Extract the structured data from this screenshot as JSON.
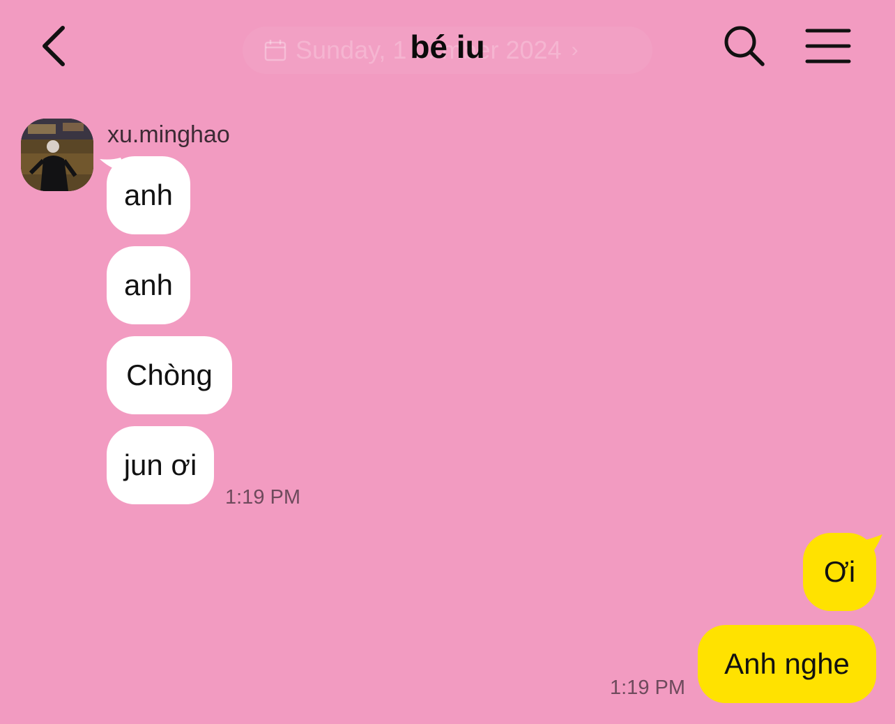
{
  "header": {
    "title": "bé iu",
    "date_label": "Sunday, 1 ... mber 2024",
    "back_icon": "chevron-left-icon",
    "search_icon": "search-icon",
    "menu_icon": "hamburger-menu-icon"
  },
  "colors": {
    "background": "#f29bc1",
    "incoming_bubble": "#ffffff",
    "outgoing_bubble": "#ffe200",
    "timestamp": "#6e4a5c"
  },
  "conversation": {
    "sender_name": "xu.minghao",
    "incoming": [
      {
        "text": "anh"
      },
      {
        "text": "anh"
      },
      {
        "text": "Chòng"
      },
      {
        "text": "jun ơi"
      }
    ],
    "incoming_time": "1:19 PM",
    "outgoing": [
      {
        "text": "Ơi"
      },
      {
        "text": "Anh nghe"
      }
    ],
    "outgoing_time": "1:19 PM"
  }
}
